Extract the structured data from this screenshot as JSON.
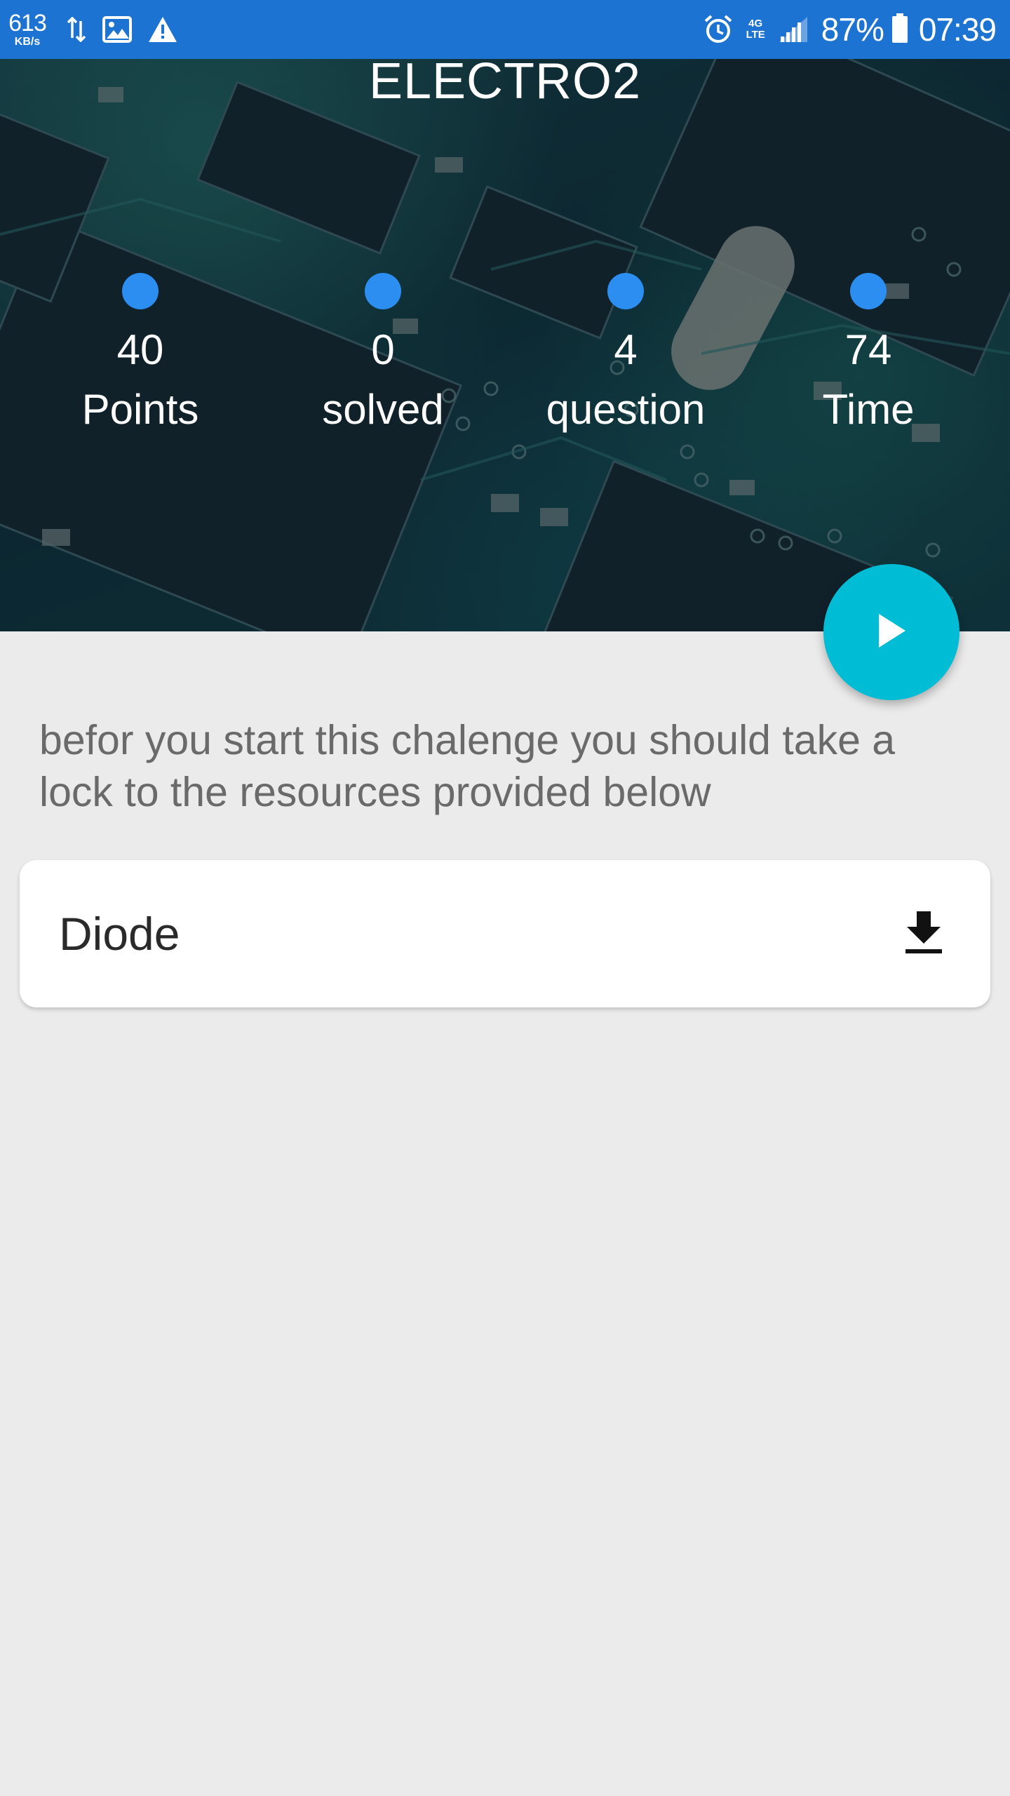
{
  "status_bar": {
    "net_speed_value": "613",
    "net_speed_unit": "KB/s",
    "battery_percent": "87%",
    "time": "07:39",
    "network_type_top": "4G",
    "network_type_bottom": "LTE",
    "icons": [
      "data-transfer-icon",
      "image-icon",
      "warning-icon",
      "alarm-icon",
      "lte-icon",
      "signal-icon",
      "battery-icon"
    ]
  },
  "header": {
    "title": "ELECTRO2",
    "stats": [
      {
        "value": "40",
        "label": "Points"
      },
      {
        "value": "0",
        "label": "solved"
      },
      {
        "value": "4",
        "label": "question"
      },
      {
        "value": "74",
        "label": "Time"
      }
    ]
  },
  "fab": {
    "icon": "play-icon",
    "color": "#00bcd4"
  },
  "description": "befor you start this chalenge you should take a lock to the resources provided below",
  "resources": [
    {
      "name": "Diode",
      "action_icon": "download-icon"
    }
  ],
  "colors": {
    "status_bar": "#1c73d2",
    "stat_dot": "#2b8ef0",
    "background": "#ebebeb",
    "accent": "#00bcd4"
  }
}
